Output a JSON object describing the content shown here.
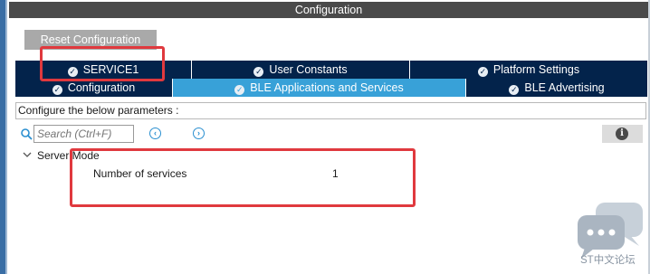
{
  "titlebar": {
    "title": "Configuration"
  },
  "toolbar": {
    "reset_label": "Reset Configuration"
  },
  "tabs_row1": [
    {
      "label": "SERVICE1",
      "active": false
    },
    {
      "label": "User Constants",
      "active": false
    },
    {
      "label": "Platform Settings",
      "active": false
    }
  ],
  "tabs_row2": [
    {
      "label": "Configuration",
      "active": false
    },
    {
      "label": "BLE Applications and Services",
      "active": true
    },
    {
      "label": "BLE Advertising",
      "active": false
    }
  ],
  "params": {
    "caption": "Configure the below parameters :"
  },
  "search": {
    "placeholder": "Search (Ctrl+F)"
  },
  "tree": {
    "group_label": "Server Mode",
    "rows": [
      {
        "label": "Number of services",
        "value": "1"
      }
    ]
  },
  "watermark": {
    "text": "ST中文论坛"
  },
  "colors": {
    "tab_dark": "#03234b",
    "tab_active": "#38a1d8",
    "highlight": "#e0393e",
    "titlebar": "#4a4a4a"
  }
}
